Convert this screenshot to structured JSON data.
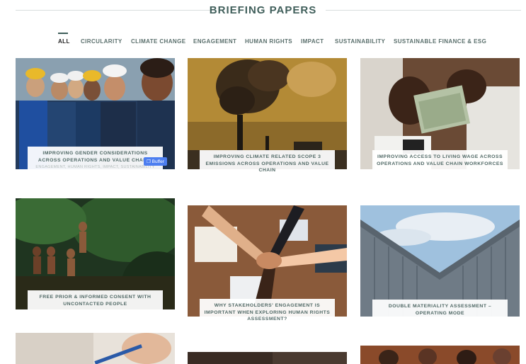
{
  "page": {
    "title": "BRIEFING PAPERS"
  },
  "filters": [
    {
      "label": "ALL",
      "active": true
    },
    {
      "label": "CIRCULARITY"
    },
    {
      "label": "CLIMATE CHANGE"
    },
    {
      "label": "ENGAGEMENT"
    },
    {
      "label": "HUMAN RIGHTS"
    },
    {
      "label": "IMPACT"
    },
    {
      "label": "SUSTAINABILITY"
    },
    {
      "label": "SUSTAINABLE FINANCE & ESG"
    }
  ],
  "cards": [
    {
      "title": "IMPROVING GENDER CONSIDERATIONS ACROSS OPERATIONS AND VALUE CHAINS",
      "tags": "ENGAGEMENT, HUMAN RIGHTS, IMPACT, SUSTAINABILITY",
      "image": "workers-group-photo",
      "buffer": "Buffer"
    },
    {
      "title": "IMPROVING CLIMATE RELATED SCOPE 3 EMISSIONS ACROSS OPERATIONS AND VALUE CHAIN",
      "image": "industrial-smoke-photo"
    },
    {
      "title": "IMPROVING ACCESS TO LIVING WAGE ACROSS OPERATIONS AND VALUE CHAIN WORKFORCES",
      "image": "counting-money-photo"
    },
    {
      "title": "FREE PRIOR & INFORMED CONSENT WITH UNCONTACTED PEOPLE",
      "image": "forest-people-photo"
    },
    {
      "title": "WHY STAKEHOLDERS' ENGAGEMENT IS IMPORTANT WHEN EXPLORING HUMAN RIGHTS ASSESSMENT?",
      "image": "stacked-hands-photo"
    },
    {
      "title": "DOUBLE MATERIALITY ASSESSMENT – OPERATING MODE",
      "image": "glass-building-photo"
    },
    {
      "image": "pen-signing-photo"
    },
    {
      "image": "dark-interior-photo"
    },
    {
      "image": "meeting-people-photo"
    }
  ],
  "colors": {
    "heading": "#3f5e5a",
    "caption_text": "#4e6764",
    "buffer_button": "#4c7ef0"
  }
}
